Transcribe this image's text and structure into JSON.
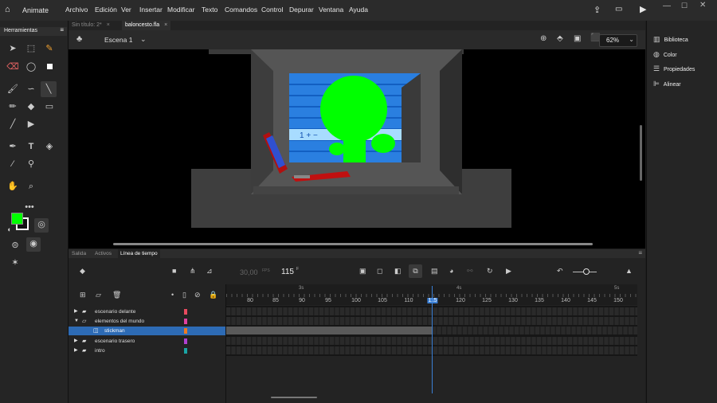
{
  "app": {
    "name": "Animate"
  },
  "menu": [
    "Archivo",
    "Edición",
    "Ver",
    "Insertar",
    "Modificar",
    "Texto",
    "Comandos",
    "Control",
    "Depurar",
    "Ventana",
    "Ayuda"
  ],
  "tools_panel": {
    "title": "Herramientas"
  },
  "doc_tabs": [
    {
      "label": "Sin título: 2*",
      "active": false
    },
    {
      "label": "baloncesto.fla",
      "active": true
    }
  ],
  "scene": {
    "name": "Escena 1",
    "zoom": "62%"
  },
  "right_panel": {
    "items": [
      "Biblioteca",
      "Color",
      "Propiedades",
      "Alinear"
    ]
  },
  "panel_tabs": [
    {
      "label": "Salida",
      "active": false
    },
    {
      "label": "Activos",
      "active": false
    },
    {
      "label": "Línea de tiempo",
      "active": true
    }
  ],
  "timeline": {
    "fps": "30,00",
    "fps_unit": "FPS",
    "frame": "115",
    "frame_unit": "F",
    "seconds_markers": [
      "3s",
      "4s",
      "5s"
    ],
    "ruler": [
      "80",
      "85",
      "90",
      "95",
      "100",
      "105",
      "110",
      "115",
      "120",
      "125",
      "130",
      "135",
      "140",
      "145",
      "150"
    ],
    "layers": [
      {
        "name": "escenario delante",
        "color": "#e84a5f"
      },
      {
        "name": "elementos del mundo",
        "color": "#e040a0"
      },
      {
        "name": "stickman",
        "color": "#f07a20",
        "selected": true
      },
      {
        "name": "escenario trasero",
        "color": "#b040d0"
      },
      {
        "name": "intro",
        "color": "#1aa5a5"
      }
    ]
  },
  "colors": {
    "accent": "#2d6bb5",
    "stroke_swatch": "#ffffff",
    "fill_swatch": "#00ff00",
    "playhead": "#3a7fd5"
  }
}
